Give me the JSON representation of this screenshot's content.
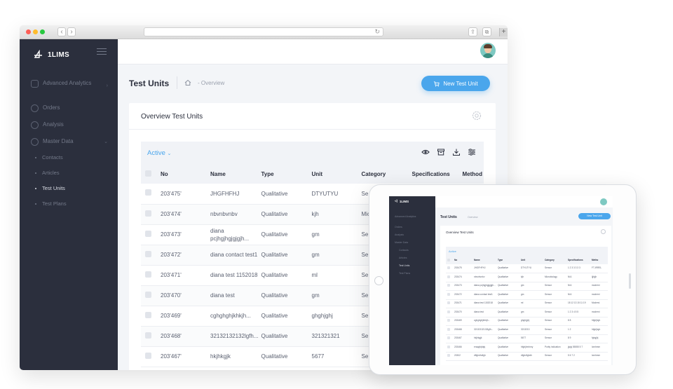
{
  "app": {
    "brand": "1LIMS"
  },
  "sidebar": {
    "items": [
      {
        "label": "Advanced Analytics",
        "icon": "chart-icon",
        "has_children": true
      },
      {
        "label": "Orders",
        "icon": "orders-icon"
      },
      {
        "label": "Analysis",
        "icon": "analysis-icon"
      },
      {
        "label": "Master Data",
        "icon": "cloud-icon",
        "has_children": true
      }
    ],
    "sub_items": [
      {
        "label": "Contacts",
        "active": false
      },
      {
        "label": "Articles",
        "active": false
      },
      {
        "label": "Test Units",
        "active": true
      },
      {
        "label": "Test Plans",
        "active": false
      }
    ]
  },
  "header": {
    "title": "Test Units",
    "breadcrumb": "Overview",
    "new_button": "New Test Unit"
  },
  "card": {
    "title": "Overview Test Units",
    "filter": "Active"
  },
  "table": {
    "columns": [
      "No",
      "Name",
      "Type",
      "Unit",
      "Category",
      "Specifications",
      "Method"
    ],
    "rows": [
      [
        "203'475'",
        "JHGFHFHJ",
        "Qualitative",
        "DTYUTYU",
        "Se"
      ],
      [
        "203'474'",
        "nbvnbvnbv",
        "Qualitative",
        "kjh",
        "Mic"
      ],
      [
        "203'473'",
        "diana pcjhgjhgjgjgjh...",
        "Qualitative",
        "gm",
        "Se"
      ],
      [
        "203'472'",
        "diana contact test1",
        "Qualitative",
        "gm",
        "Se"
      ],
      [
        "203'471'",
        "diana test 1152018",
        "Qualitative",
        "ml",
        "Se"
      ],
      [
        "203'470'",
        "diana test",
        "Qualitative",
        "gm",
        "Se"
      ],
      [
        "203'469'",
        "cghghghjkhkjh...",
        "Qualitative",
        "ghghjghj",
        "Se"
      ],
      [
        "203'468'",
        "32132132132lgfh...",
        "Qualitative",
        "321321321",
        "Se"
      ],
      [
        "203'467'",
        "hkjhkgjk",
        "Qualitative",
        "5677",
        "Se"
      ]
    ]
  },
  "tablet": {
    "sidebar": [
      "Advanced Analytics",
      "Orders",
      "Analysis",
      "Master Data",
      "Contacts",
      "Articles",
      "Test Units",
      "Test Plans"
    ],
    "columns": [
      "No",
      "Name",
      "Type",
      "Unit",
      "Category",
      "Specifications",
      "Metho"
    ],
    "rows": [
      [
        "203475",
        "JHGFHFHJ",
        "Qualitative",
        "DTYUTYU",
        "Sensor",
        "1 2 3 3 3 3 3",
        "FT-IRREL"
      ],
      [
        "203474",
        "nbvnbvnbv",
        "Qualitative",
        "kjh",
        "Microbiology",
        "N/A",
        "ljjhjjh"
      ],
      [
        "203473",
        "diana pcjhgjhgjgjgjh...",
        "Qualitative",
        "gm",
        "Sensor",
        "N/A",
        "moderni"
      ],
      [
        "203472",
        "diana contact test1",
        "Qualitative",
        "gm",
        "Sensor",
        "N/A",
        "moderni"
      ],
      [
        "203471",
        "diana test 1152018",
        "Qualitative",
        "ml",
        "Sensor",
        "18 12 13 15 11 19",
        "Modersi"
      ],
      [
        "203470",
        "diana test",
        "Qualitative",
        "gm",
        "Sensor",
        "1 2 3 4 5 5",
        "moderni"
      ],
      [
        "203469",
        "cghghghjkhkjh...",
        "Qualitative",
        "ghghjghj",
        "Sensor",
        "8 8",
        "hfghjhgh"
      ],
      [
        "203468",
        "32132132132lgfh...",
        "Qualitative",
        "3213213",
        "Sensor",
        "1 2",
        "hfghjhgh"
      ],
      [
        "203467",
        "hkjhkgjk",
        "Qualitative",
        "5677",
        "Sensor",
        "8 9",
        "fghgjhj"
      ],
      [
        "203466",
        "eraqqfqfqfq",
        "Qualitative",
        "hfghjhmhmy",
        "Purity indication",
        "jjsjsj 55555 5 7",
        "lcmhmm"
      ],
      [
        "20302",
        "dffghdhdfgh",
        "Qualitative",
        "dfghdfghdh",
        "Sensor",
        "5 6 7 2",
        "lcmhmm"
      ]
    ]
  }
}
